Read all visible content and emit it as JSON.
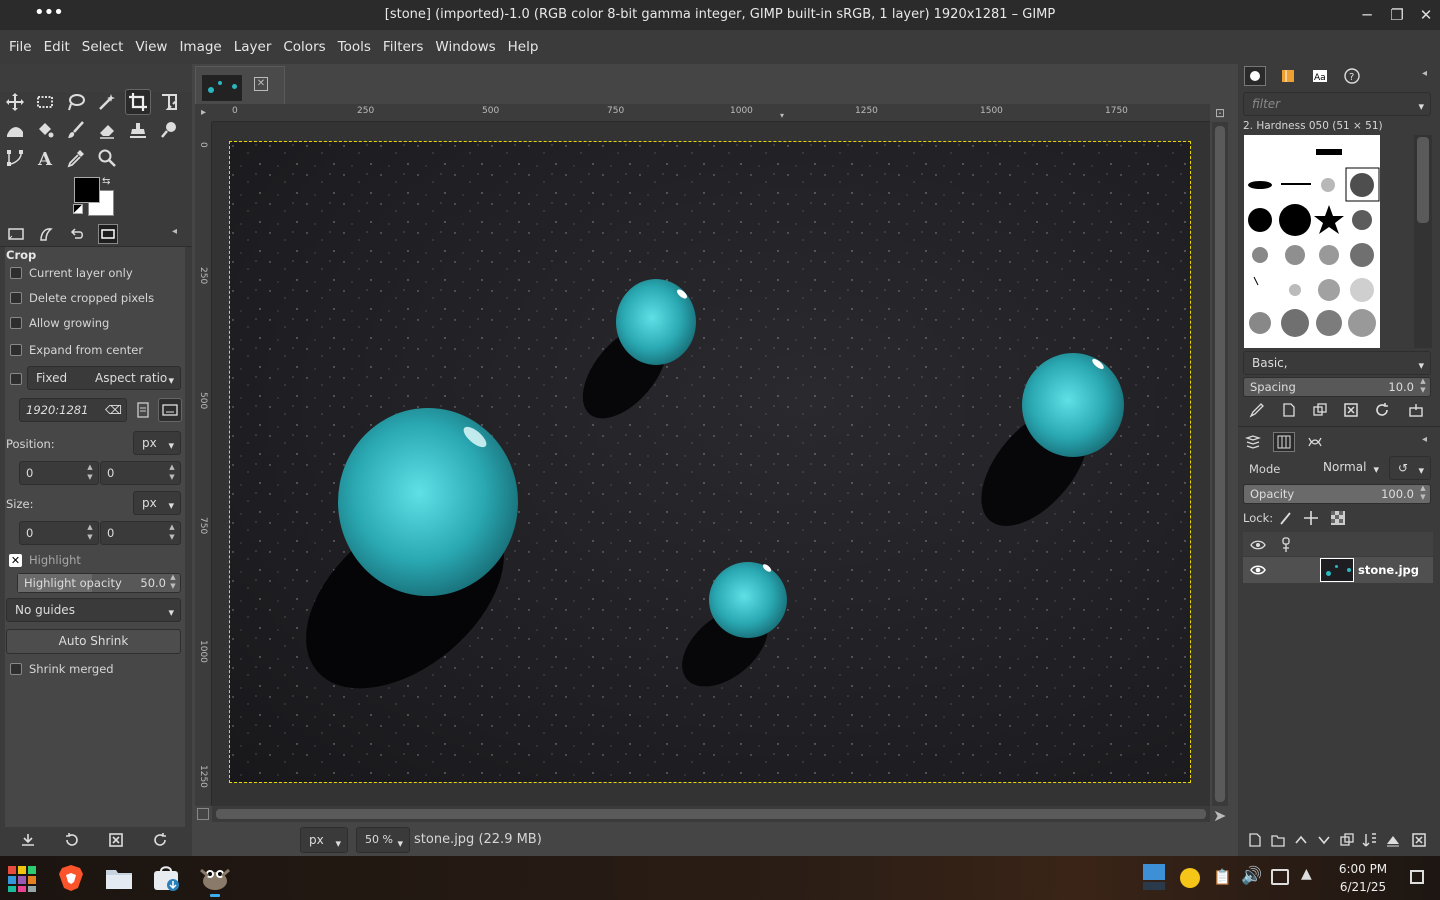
{
  "window": {
    "title": "[stone] (imported)-1.0 (RGB color 8-bit gamma integer, GIMP built-in sRGB, 1 layer) 1920x1281 – GIMP",
    "menu_dots": "•••"
  },
  "menu": [
    "File",
    "Edit",
    "Select",
    "View",
    "Image",
    "Layer",
    "Colors",
    "Tools",
    "Filters",
    "Windows",
    "Help"
  ],
  "tool_options": {
    "title": "Crop",
    "current_layer_only": "Current layer only",
    "delete_cropped": "Delete cropped pixels",
    "allow_growing": "Allow growing",
    "expand_from_center": "Expand from center",
    "fixed_label": "Fixed",
    "fixed_mode": "Aspect ratio",
    "ratio_value": "1920:1281",
    "position_label": "Position:",
    "position_unit": "px",
    "position_x": "0",
    "position_y": "0",
    "size_label": "Size:",
    "size_unit": "px",
    "size_w": "0",
    "size_h": "0",
    "highlight": "Highlight",
    "highlight_opacity_label": "Highlight opacity",
    "highlight_opacity_value": "50.0",
    "guides": "No guides",
    "auto_shrink": "Auto Shrink",
    "shrink_merged": "Shrink merged"
  },
  "rulers": {
    "h_ticks": [
      "0",
      "250",
      "500",
      "750",
      "1000",
      "1250",
      "1500",
      "1750"
    ],
    "v_ticks": [
      "0",
      "250",
      "500",
      "750",
      "1000",
      "1250"
    ]
  },
  "status": {
    "unit": "px",
    "zoom": "50 %",
    "file_info": "stone.jpg (22.9 MB)"
  },
  "brushes": {
    "filter_placeholder": "filter",
    "current": "2. Hardness 050 (51 × 51)",
    "tag": "Basic,",
    "spacing_label": "Spacing",
    "spacing_value": "10.0"
  },
  "layers": {
    "mode_label": "Mode",
    "mode_value": "Normal",
    "opacity_label": "Opacity",
    "opacity_value": "100.0",
    "lock_label": "Lock:",
    "layer_name": "stone.jpg"
  },
  "taskbar": {
    "time": "6:00 PM",
    "date": "6/21/25"
  },
  "colors": {
    "accent_cyan": "#2ab7c0",
    "selection_dash": "#e8d700"
  }
}
